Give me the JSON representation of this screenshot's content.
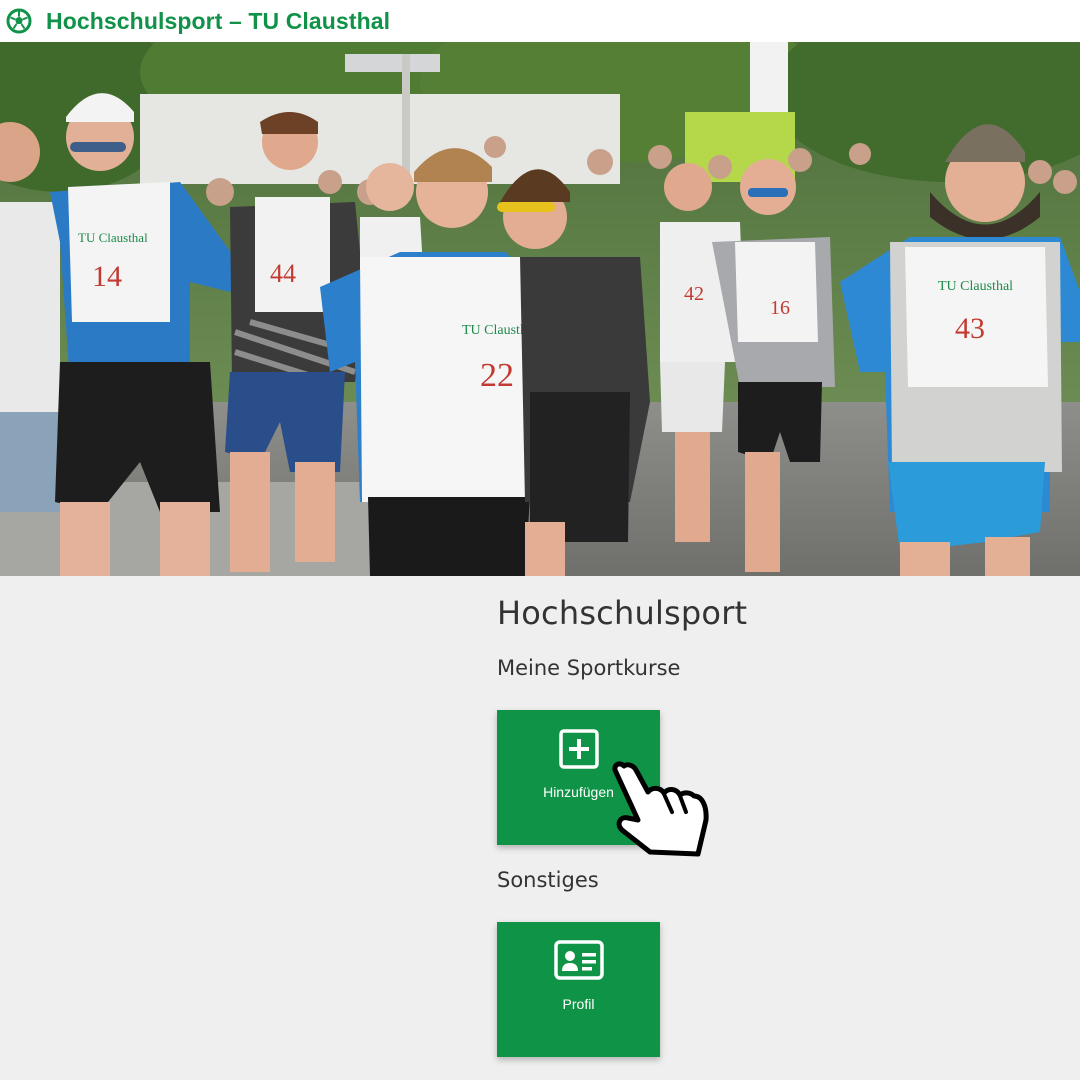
{
  "header": {
    "title": "Hochschulsport – TU Clausthal",
    "logo_icon": "soccer-ball-icon"
  },
  "hero": {
    "bib_numbers": [
      "14",
      "44",
      "22",
      "16",
      "42",
      "43"
    ],
    "bib_text": "TU Clausthal"
  },
  "main": {
    "page_title": "Hochschulsport",
    "sections": [
      {
        "heading": "Meine Sportkurse",
        "tiles": [
          {
            "label": "Hinzufügen",
            "icon": "plus-square-icon"
          }
        ]
      },
      {
        "heading": "Sonstiges",
        "tiles": [
          {
            "label": "Profil",
            "icon": "id-card-icon"
          }
        ]
      }
    ]
  },
  "colors": {
    "brand_green": "#109248",
    "tile_green": "#0f9447",
    "background": "#efefef",
    "text": "#333333"
  },
  "cursor_icon": "hand-pointer-icon"
}
